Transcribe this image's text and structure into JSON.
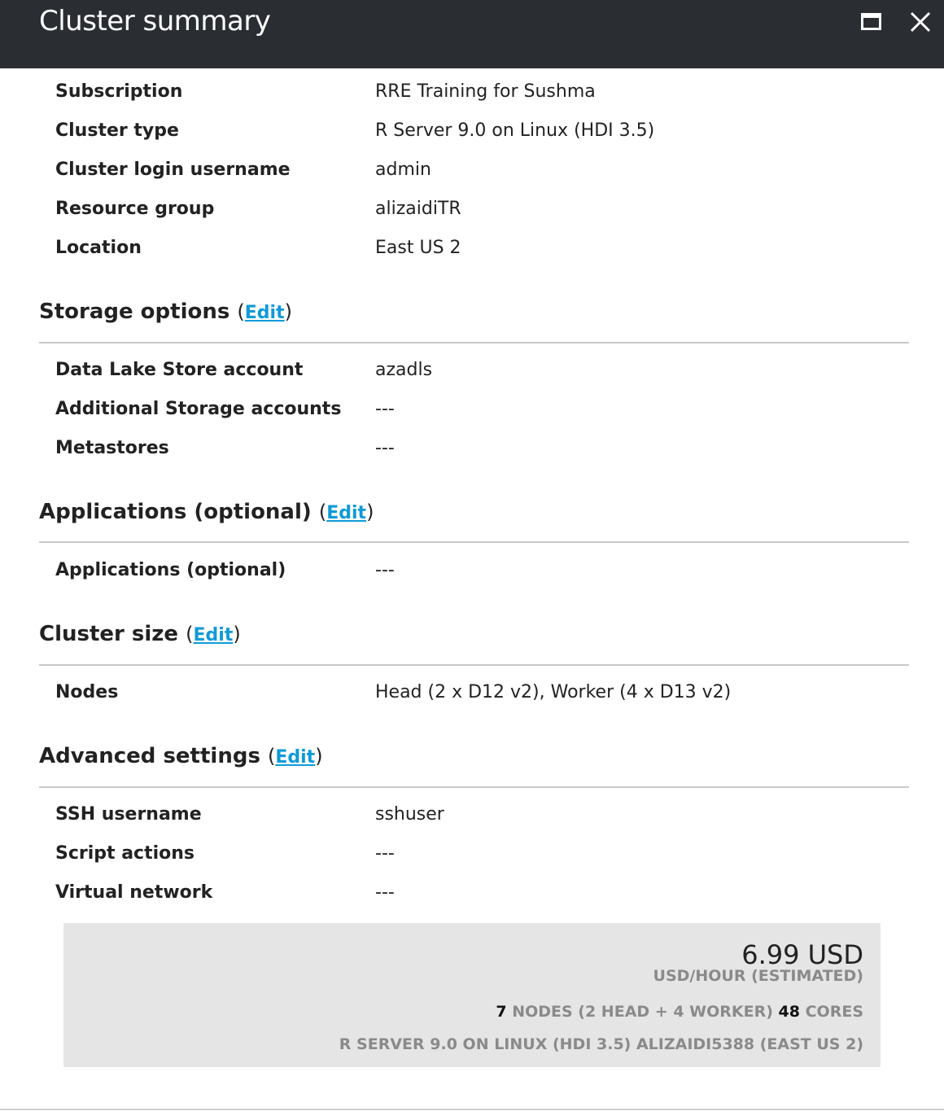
{
  "window": {
    "title": "Cluster summary"
  },
  "basics": [
    {
      "label": "Subscription",
      "value": "RRE Training for Sushma"
    },
    {
      "label": "Cluster type",
      "value": "R Server 9.0 on Linux (HDI 3.5)"
    },
    {
      "label": "Cluster login username",
      "value": "admin"
    },
    {
      "label": "Resource group",
      "value": "alizaidiTR"
    },
    {
      "label": "Location",
      "value": "East US 2"
    }
  ],
  "storage": {
    "title": "Storage options",
    "edit_label": "Edit",
    "rows": [
      {
        "label": "Data Lake Store account",
        "value": "azadls"
      },
      {
        "label": "Additional Storage accounts",
        "value": "---"
      },
      {
        "label": "Metastores",
        "value": "---"
      }
    ]
  },
  "applications": {
    "title": "Applications (optional)",
    "edit_label": "Edit",
    "rows": [
      {
        "label": "Applications (optional)",
        "value": "---"
      }
    ]
  },
  "cluster_size": {
    "title": "Cluster size",
    "edit_label": "Edit",
    "rows": [
      {
        "label": "Nodes",
        "value": "Head (2 x D12 v2), Worker (4 x D13 v2)"
      }
    ]
  },
  "advanced": {
    "title": "Advanced settings",
    "edit_label": "Edit",
    "rows": [
      {
        "label": "SSH username",
        "value": "sshuser"
      },
      {
        "label": "Script actions",
        "value": "---"
      },
      {
        "label": "Virtual network",
        "value": "---"
      }
    ]
  },
  "summary": {
    "price": "6.99 USD",
    "price_unit": "USD/HOUR (ESTIMATED)",
    "node_count": "7",
    "nodes_text": "NODES (2 HEAD + 4 WORKER)",
    "core_count": "48",
    "cores_text": "CORES",
    "config": "R SERVER 9.0 ON LINUX (HDI 3.5) ALIZAIDI5388 (EAST US 2)"
  }
}
